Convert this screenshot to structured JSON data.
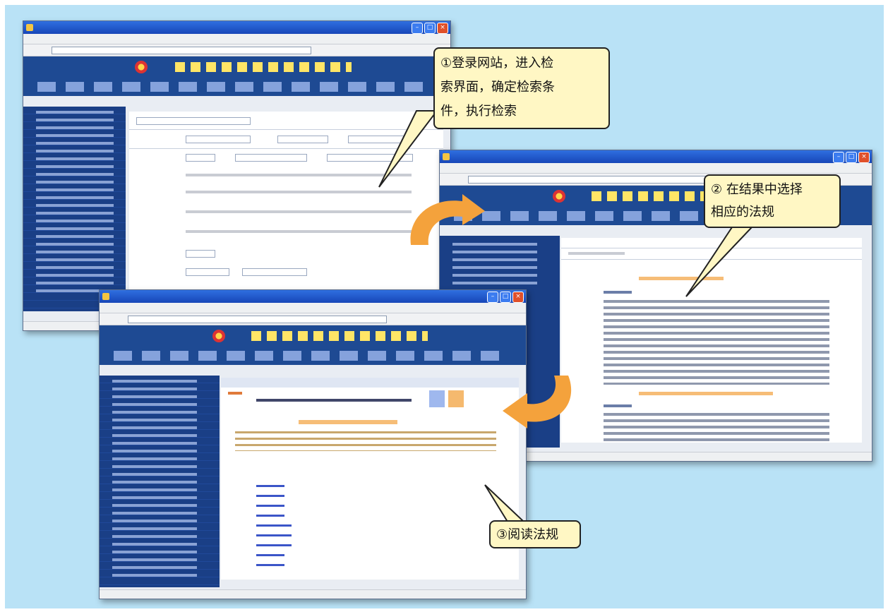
{
  "callouts": {
    "step1": "①登录网站，进入检索界面，确定检索条件，执行检索",
    "step1_lines": [
      "①登录网站，进入检",
      "索界面，确定检索条",
      "件，执行检索"
    ],
    "step2_lines": [
      "② 在结果中选择",
      "相应的法规"
    ],
    "step3": "③阅读法规"
  },
  "colors": {
    "background": "#b9e2f6",
    "callout_fill": "#fff7c4",
    "arrow": "#f4a23c",
    "window_header": "#1e4a93"
  },
  "icons": [
    "window-app-icon",
    "minimize-icon",
    "maximize-icon",
    "close-icon",
    "emblem-icon",
    "curved-arrow-icon"
  ]
}
